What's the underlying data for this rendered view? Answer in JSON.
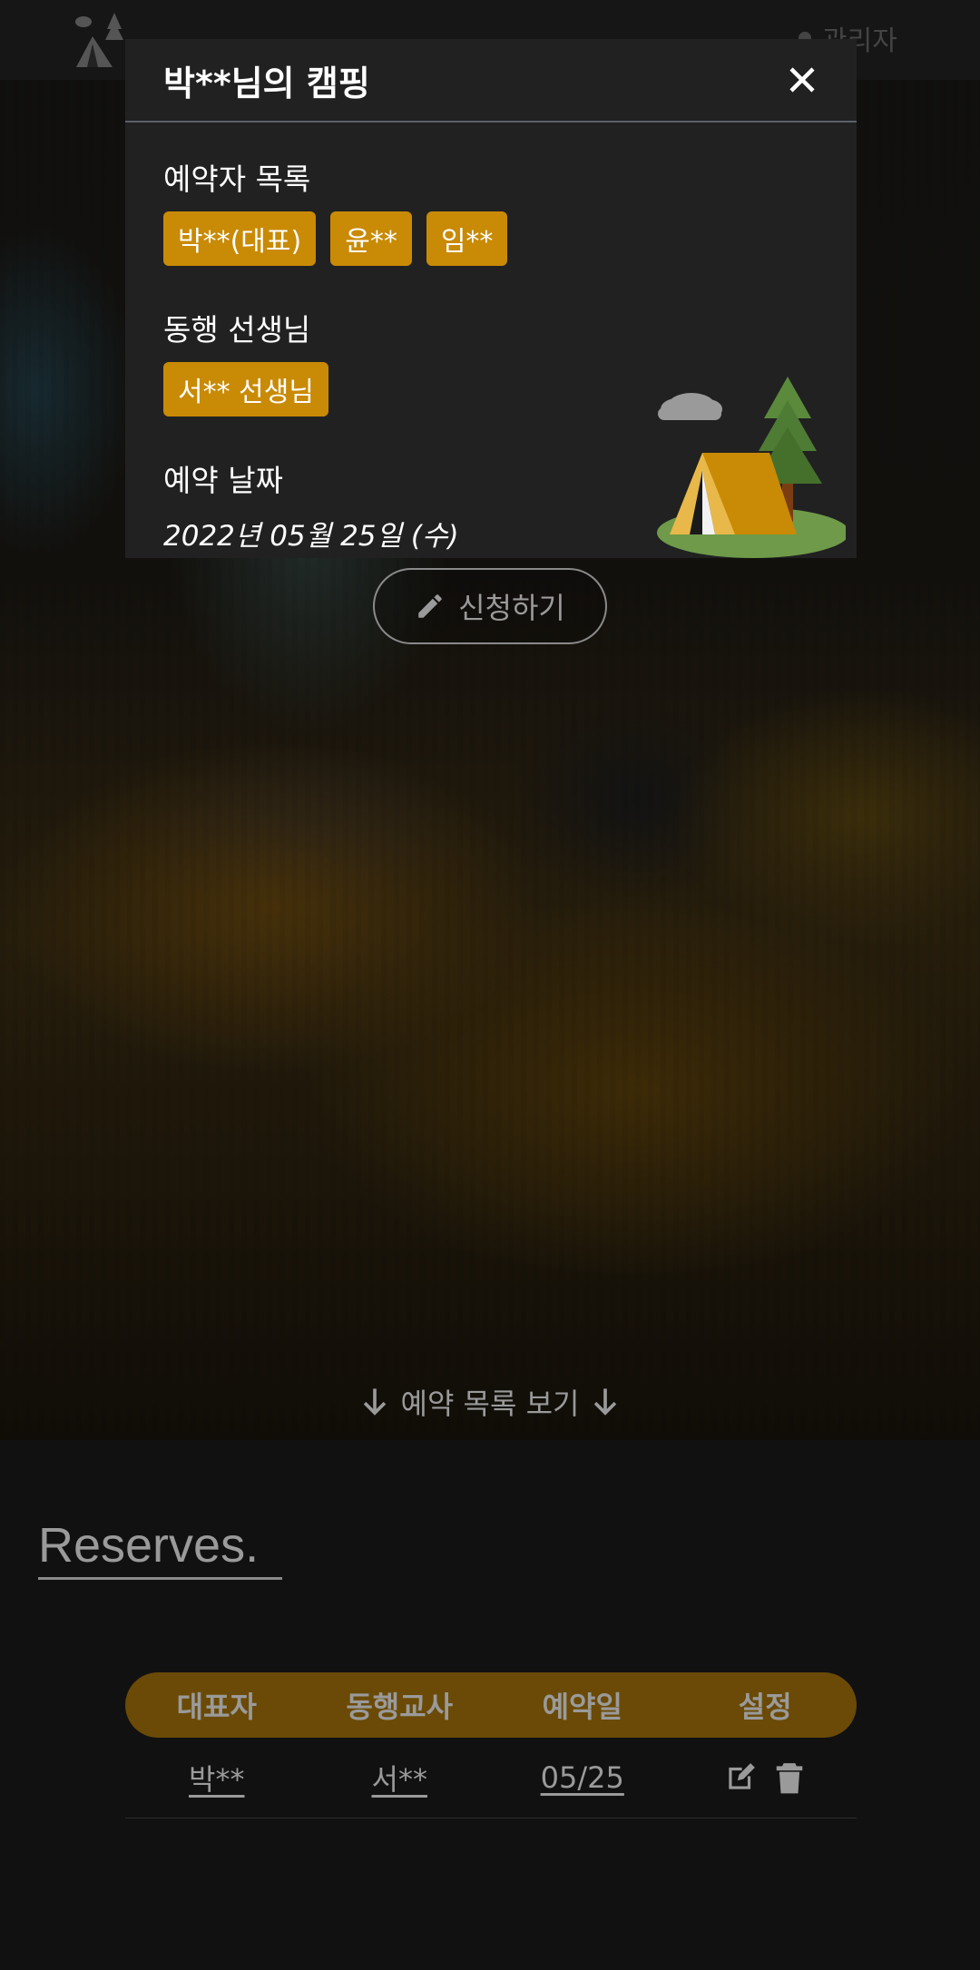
{
  "nav": {
    "admin_label": "관리자"
  },
  "modal": {
    "title": "박**님의 캠핑",
    "reservers_label": "예약자 목록",
    "reservers": [
      "박**(대표)",
      "윤**",
      "임**"
    ],
    "teacher_label": "동행 선생님",
    "teachers": [
      "서** 선생님"
    ],
    "date_label": "예약 날짜",
    "date_value": "2022년 05월 25일 (수)"
  },
  "hero": {
    "apply_label": "신청하기",
    "view_list_label": "예약 목록 보기"
  },
  "reserves": {
    "title": "Reserves.",
    "headers": [
      "대표자",
      "동행교사",
      "예약일",
      "설정"
    ],
    "rows": [
      {
        "leader": "박**",
        "teacher": "서**",
        "date": "05/25"
      }
    ]
  },
  "icons": {
    "logo": "camping-tent-logo-icon",
    "admin": "user-dot-icon",
    "close": "close-icon",
    "apply": "pencil-icon",
    "arrow": "arrow-down-icon",
    "edit": "edit-icon",
    "delete": "trash-icon"
  },
  "colors": {
    "accent": "#c98a05",
    "table_header": "#6a4a06",
    "modal_bg": "#212121",
    "page_bg": "#111111"
  }
}
